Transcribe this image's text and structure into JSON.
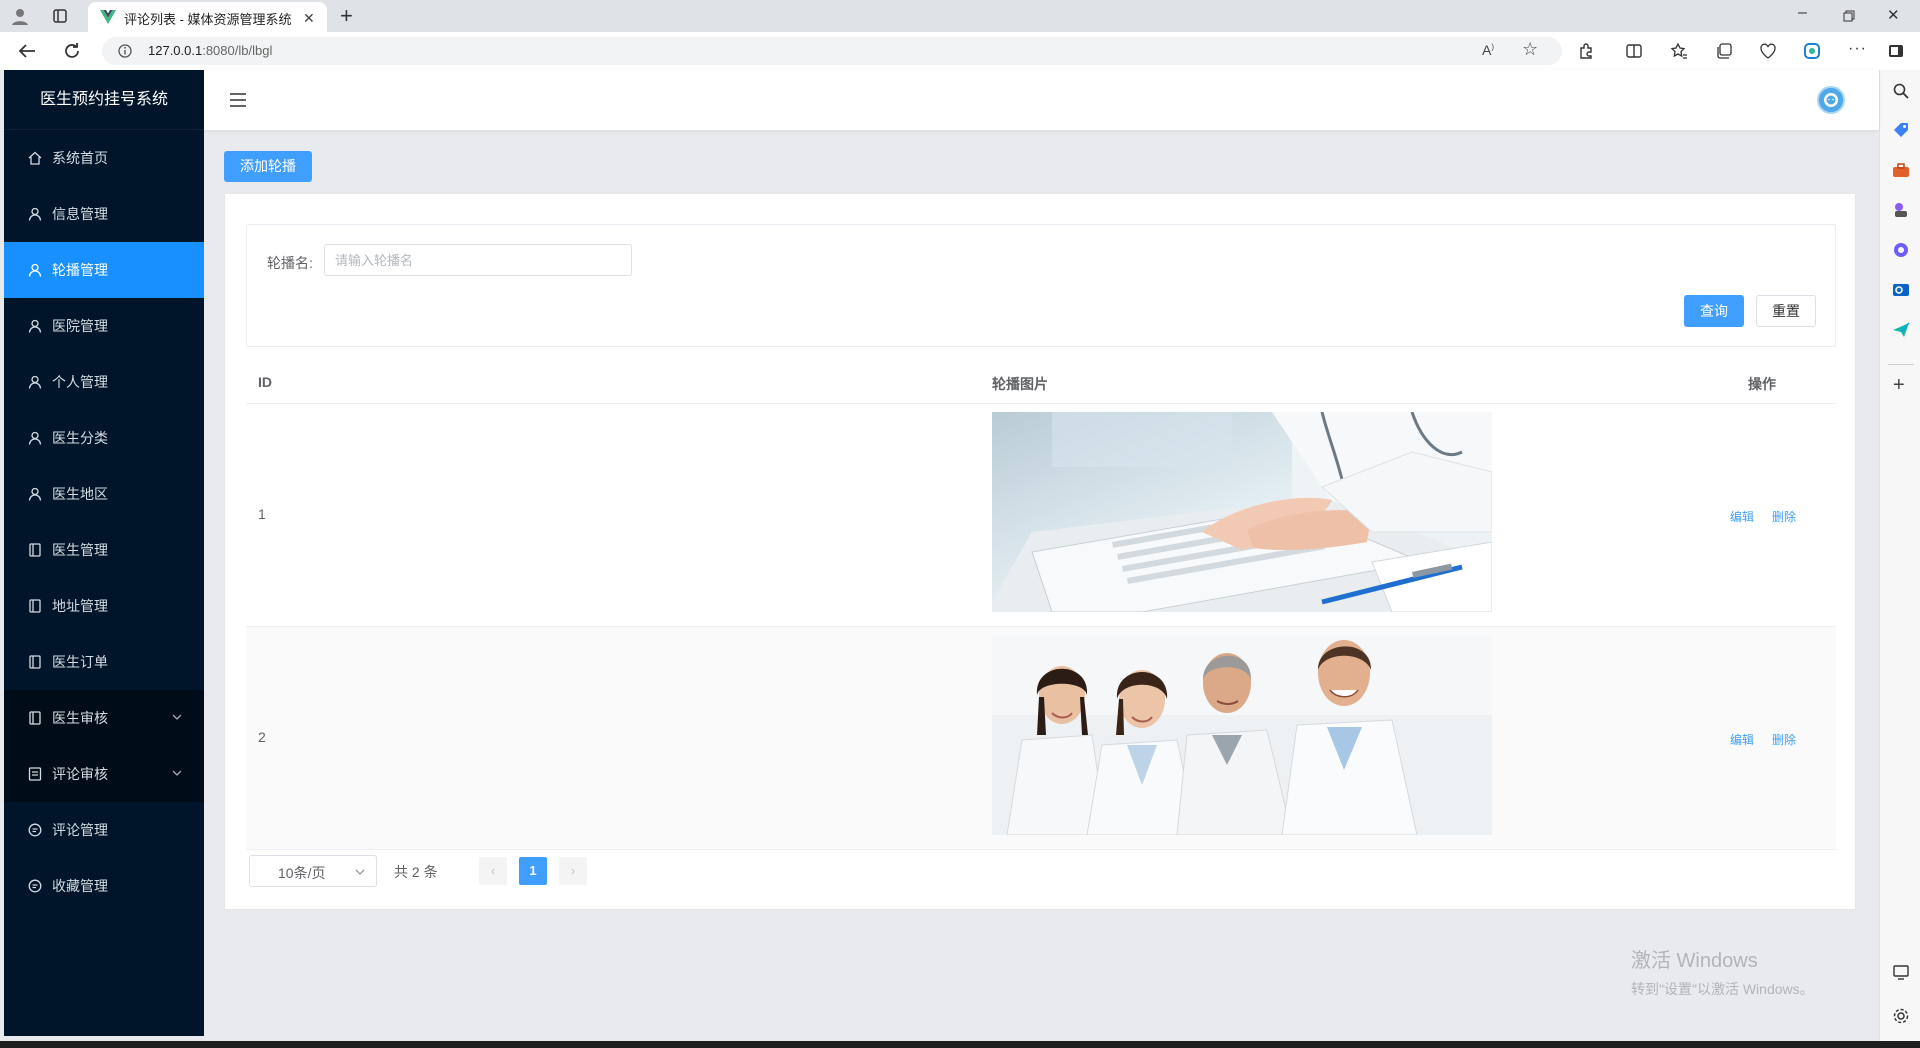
{
  "browser": {
    "tab_title": "评论列表 - 媒体资源管理系统",
    "url_host": "127.0.0.1",
    "url_rest": ":8080/lb/lbgl"
  },
  "sidebar": {
    "logo": "医生预约挂号系统",
    "items": [
      {
        "label": "系统首页",
        "icon": "home-icon"
      },
      {
        "label": "信息管理",
        "icon": "user-icon"
      },
      {
        "label": "轮播管理",
        "icon": "user-icon",
        "active": true
      },
      {
        "label": "医院管理",
        "icon": "user-icon"
      },
      {
        "label": "个人管理",
        "icon": "user-icon"
      },
      {
        "label": "医生分类",
        "icon": "user-icon"
      },
      {
        "label": "医生地区",
        "icon": "user-icon"
      },
      {
        "label": "医生管理",
        "icon": "document-icon"
      },
      {
        "label": "地址管理",
        "icon": "document-icon"
      },
      {
        "label": "医生订单",
        "icon": "document-icon"
      },
      {
        "label": "医生审核",
        "icon": "document-icon",
        "submenu": true
      },
      {
        "label": "评论审核",
        "icon": "list-icon",
        "submenu": true
      },
      {
        "label": "评论管理",
        "icon": "chat-icon"
      },
      {
        "label": "收藏管理",
        "icon": "chat-icon"
      }
    ]
  },
  "main": {
    "add_button": "添加轮播",
    "search": {
      "label": "轮播名:",
      "placeholder": "请输入轮播名",
      "query_button": "查询",
      "reset_button": "重置"
    },
    "table": {
      "columns": [
        "ID",
        "轮播图片",
        "操作"
      ],
      "rows": [
        {
          "id": "1",
          "image": "doctor-typing-keyboard-photo",
          "edit": "编辑",
          "delete": "删除"
        },
        {
          "id": "2",
          "image": "medical-team-photo",
          "edit": "编辑",
          "delete": "删除"
        }
      ]
    },
    "pagination": {
      "page_size": "10条/页",
      "total": "共 2 条",
      "current_page": "1"
    }
  },
  "watermark": {
    "line1": "激活 Windows",
    "line2": "转到\"设置\"以激活 Windows。"
  },
  "colors": {
    "primary": "#409eff",
    "sidebar_bg": "#00152a",
    "sidebar_active": "#1890ff"
  }
}
